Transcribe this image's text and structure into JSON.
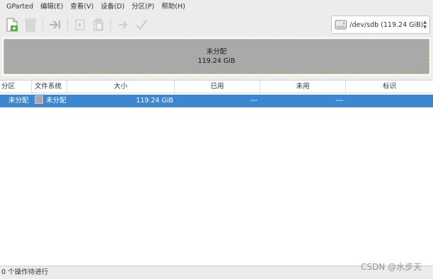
{
  "menu": {
    "items": [
      "GParted",
      "编辑(E)",
      "查看(V)",
      "设备(D)",
      "分区(P)",
      "帮助(H)"
    ]
  },
  "toolbar": {
    "buttons": [
      {
        "name": "new-partition",
        "icon": "new-document-icon",
        "enabled": true
      },
      {
        "name": "delete-partition",
        "icon": "trash-icon",
        "enabled": false
      },
      {
        "name": "resize-move",
        "icon": "arrow-right-icon",
        "enabled": false
      },
      {
        "name": "copy",
        "icon": "copy-icon",
        "enabled": false
      },
      {
        "name": "paste",
        "icon": "paste-icon",
        "enabled": false
      },
      {
        "name": "undo",
        "icon": "undo-icon",
        "enabled": false
      },
      {
        "name": "apply",
        "icon": "checkmark-icon",
        "enabled": false
      }
    ]
  },
  "device": {
    "label": "/dev/sdb   (119.24 GiB)",
    "icon": "disk-drive-icon"
  },
  "disk_visual": {
    "name": "未分配",
    "size": "119.24 GiB",
    "colors": {
      "unallocated": "#a9a9a9",
      "border": "#c8d48e"
    }
  },
  "table": {
    "headers": [
      "分区",
      "文件系统",
      "大小",
      "已用",
      "未用",
      "标识"
    ],
    "rows": [
      {
        "partition": "未分配",
        "filesystem": "未分配",
        "size": "119.24 GiB",
        "used": "---",
        "unused": "---",
        "flags": ""
      }
    ],
    "selection_color": "#3d87d1"
  },
  "status": {
    "text": "0 个操作待进行"
  },
  "watermark": "CSDN @水步天"
}
